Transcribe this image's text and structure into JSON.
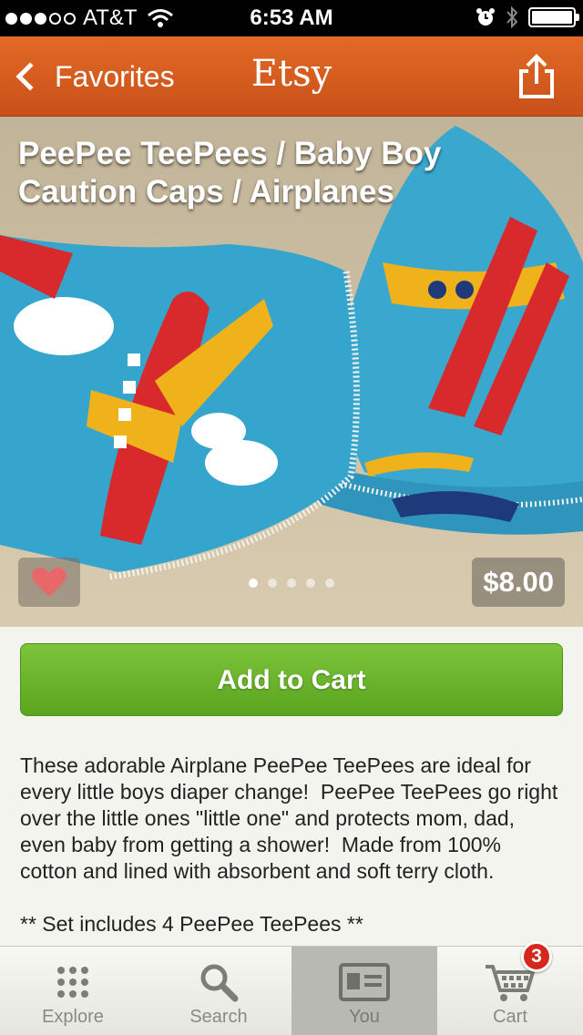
{
  "status_bar": {
    "carrier": "AT&T",
    "time": "6:53 AM",
    "signal_bars": 3
  },
  "nav": {
    "back_label": "Favorites",
    "title": "Etsy",
    "share_icon": "share-icon"
  },
  "listing": {
    "title": "PeePee TeePees / Baby Boy Caution Caps / Airplanes",
    "price": "$8.00",
    "image_count": 5,
    "current_image": 1,
    "favorite_icon": "heart-icon",
    "add_to_cart_label": "Add to Cart",
    "description_paragraphs": [
      "These adorable Airplane PeePee TeePees are ideal for every little boys diaper change!  PeePee TeePees go right over the little ones \"little one\" and protects mom, dad, even baby from getting a shower!  Made from 100% cotton and lined with absorbent and soft terry cloth.",
      "** Set includes 4 PeePee TeePees **"
    ]
  },
  "tabbar": {
    "tabs": [
      {
        "label": "Explore",
        "icon": "grid-icon"
      },
      {
        "label": "Search",
        "icon": "search-icon"
      },
      {
        "label": "You",
        "icon": "profile-card-icon"
      },
      {
        "label": "Cart",
        "icon": "cart-icon"
      }
    ],
    "active": "You",
    "cart_badge": "3"
  },
  "colors": {
    "nav_orange": "#d55b1f",
    "add_to_cart_green": "#6bb52c",
    "badge_red": "#d5271b"
  }
}
